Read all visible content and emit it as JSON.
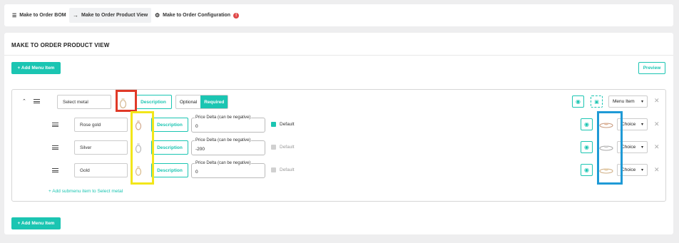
{
  "tabs": [
    {
      "label": "Make to Order BOM",
      "icon": "list-icon"
    },
    {
      "label": "Make to Order Product View",
      "icon": "arrow-right-icon"
    },
    {
      "label": "Make to Order Configuration",
      "icon": "gear-icon",
      "badge": "!"
    }
  ],
  "page": {
    "title": "MAKE TO ORDER PRODUCT VIEW",
    "add_menu_item": "+ Add Menu Item",
    "preview": "Preview",
    "add_menu_item_bottom": "+ Add Menu Item"
  },
  "menu": {
    "name": "Select metal",
    "description_btn": "Description",
    "optional": "Optional",
    "required": "Required",
    "type": "Menu Item",
    "add_submenu": "+ Add submenu item to Select metal"
  },
  "choices": [
    {
      "name": "Rose gold",
      "description_btn": "Description",
      "price_label": "Price Delta (can be negative)",
      "price": "0",
      "default_label": "Default",
      "is_default": true,
      "type": "Choice"
    },
    {
      "name": "Silver",
      "description_btn": "Description",
      "price_label": "Price Delta (can be negative)",
      "price": "-200",
      "default_label": "Default",
      "is_default": false,
      "type": "Choice"
    },
    {
      "name": "Gold",
      "description_btn": "Description",
      "price_label": "Price Delta (can be negative)",
      "price": "0",
      "default_label": "Default",
      "is_default": false,
      "type": "Choice"
    }
  ],
  "colors": {
    "accent": "#1bc5b2",
    "highlight_red": "#e03a28",
    "highlight_yellow": "#f2e61a",
    "highlight_blue": "#1f9ad6"
  }
}
